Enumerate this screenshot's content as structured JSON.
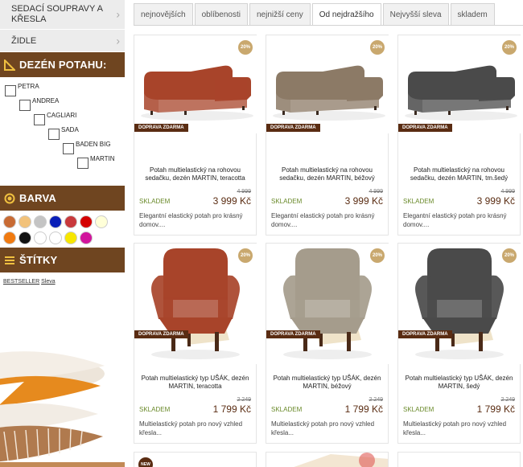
{
  "sidebar": {
    "categories": [
      {
        "label": "SEDACÍ SOUPRAVY A KŘESLA"
      },
      {
        "label": "ŽIDLE"
      }
    ],
    "pattern_heading": "DEZÉN POTAHU:",
    "patterns": [
      "PETRA",
      "ANDREA",
      "CAGLIARI",
      "SADA",
      "BADEN BIG",
      "MARTIN"
    ],
    "color_heading": "BARVA",
    "colors": [
      [
        "#c86b34",
        "#f2c27a",
        "#c4c4c4",
        "#0a1fb8",
        "#c8393c",
        "#d40000",
        "#ffffd8"
      ],
      [
        "#f07a10",
        "#111111",
        "#ffffff",
        "#ffffff",
        "#f7e600",
        "#d1159c"
      ]
    ],
    "tags_heading": "ŠTÍTKY",
    "tags": [
      "BESTSELLER",
      "Sleva"
    ]
  },
  "tabs": [
    "nejnovějších",
    "oblíbenosti",
    "nejnižší ceny",
    "Od nejdražšího",
    "Nejvyšší sleva",
    "skladem"
  ],
  "active_tab": 3,
  "products": [
    {
      "discount": "20%",
      "shipping": "DOPRAVA ZDARMA",
      "title": "Potah multielastický na rohovou sedačku, dezén MARTIN, teracotta",
      "stock": "SKLADEM",
      "old_price": "4 999",
      "price": "3 999 Kč",
      "desc": "Elegantní elastický potah pro krásný domov....",
      "color": "#a8442a"
    },
    {
      "discount": "20%",
      "shipping": "DOPRAVA ZDARMA",
      "title": "Potah multielastický na rohovou sedačku, dezén MARTIN, béžový",
      "stock": "SKLADEM",
      "old_price": "4 999",
      "price": "3 999 Kč",
      "desc": "Elegantní elastický potah pro krásný domov....",
      "color": "#8c7a66"
    },
    {
      "discount": "20%",
      "shipping": "DOPRAVA ZDARMA",
      "title": "Potah multielastický na rohovou sedačku, dezén MARTIN, tm.šedý",
      "stock": "SKLADEM",
      "old_price": "4 999",
      "price": "3 999 Kč",
      "desc": "Elegantní elastický potah pro krásný domov....",
      "color": "#4a4a4a"
    },
    {
      "discount": "20%",
      "shipping": "DOPRAVA ZDARMA",
      "title": "Potah multielastický typ UŠÁK, dezén MARTIN, teracotta",
      "stock": "SKLADEM",
      "old_price": "2 249",
      "price": "1 799 Kč",
      "desc": "Multielastický potah pro nový vzhled křesla...",
      "color": "#a8442a"
    },
    {
      "discount": "20%",
      "shipping": "DOPRAVA ZDARMA",
      "title": "Potah multielastický typ UŠÁK, dezén MARTIN, béžový",
      "stock": "SKLADEM",
      "old_price": "2 249",
      "price": "1 799 Kč",
      "desc": "Multielastický potah pro nový vzhled křesla...",
      "color": "#a59c8c"
    },
    {
      "discount": "20%",
      "shipping": "DOPRAVA ZDARMA",
      "title": "Potah multielastický typ UŠÁK, dezén MARTIN, šedý",
      "stock": "SKLADEM",
      "old_price": "2 249",
      "price": "1 799 Kč",
      "desc": "Multielastický potah pro nový vzhled křesla...",
      "color": "#4a4a4a"
    }
  ],
  "bottom_badge": "NEW"
}
